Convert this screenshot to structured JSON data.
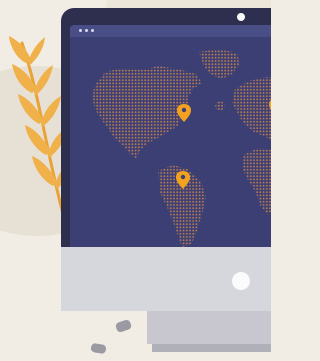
{
  "illustration": {
    "icons": {
      "plant": "wheat-branch-icon",
      "pin": "location-pin-icon"
    },
    "colors": {
      "background": "#f1ece4",
      "monitor_frame": "#2e2f4e",
      "screen": "#3c3f74",
      "land_dots": "#b87b54",
      "pin": "#f2a21e",
      "stand": "#c8c7cf"
    }
  }
}
